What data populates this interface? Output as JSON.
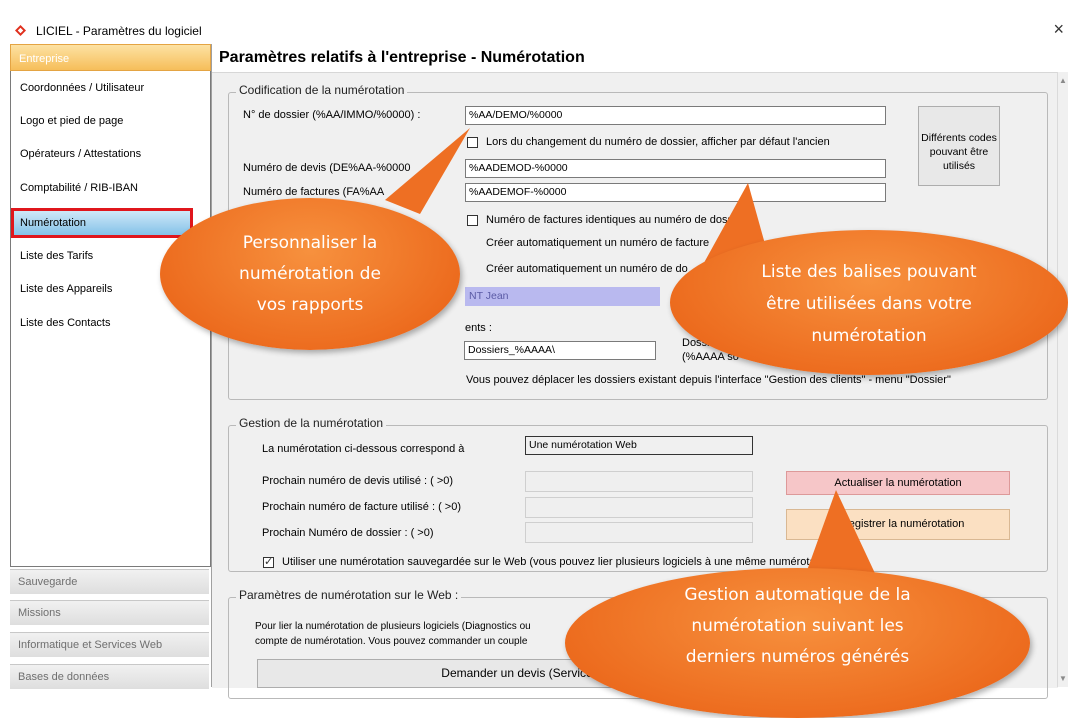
{
  "window": {
    "title": "LICIEL - Paramètres du logiciel",
    "close_glyph": "×"
  },
  "sidebar": {
    "header": "Entreprise",
    "items": [
      {
        "label": "Coordonnées / Utilisateur"
      },
      {
        "label": "Logo et pied de page"
      },
      {
        "label": "Opérateurs / Attestations"
      },
      {
        "label": "Comptabilité / RIB-IBAN"
      },
      {
        "label": "Numérotation",
        "selected": true
      },
      {
        "label": "Liste des Tarifs"
      },
      {
        "label": "Liste des Appareils"
      },
      {
        "label": "Liste des Contacts"
      }
    ],
    "groups": [
      "Sauvegarde",
      "Missions",
      "Informatique et Services Web",
      "Bases de données"
    ]
  },
  "main": {
    "title": "Paramètres relatifs à l'entreprise - Numérotation",
    "codification": {
      "legend": "Codification de la numérotation",
      "dossier_label": "N° de dossier (%AA/IMMO/%0000) :",
      "dossier_value": "%AA/DEMO/%0000",
      "change_checkbox": "Lors du changement du numéro de dossier, afficher par défaut l'ancien",
      "devis_label": "Numéro de devis (DE%AA-%0000",
      "devis_value": "%AADEMOD-%0000",
      "facture_label": "Numéro de factures (FA%AA",
      "facture_value": "%AADEMOF-%0000",
      "codes_button": "Différents codes pouvant être utilisés",
      "identiques_checkbox": "Numéro de factures identiques au numéro de dossier",
      "creer_facture_checkbox": "Créer automatiquement un numéro de facture",
      "creer_dossier_checkbox": "Créer automatiquement un numéro de do",
      "operator_value": "NT Jean",
      "documents_label": "ents :",
      "dossiers_value": "Dossiers_%AAAA\\",
      "dossier_hint_1": "Dossi",
      "dossier_hint_2": "(%AAAA so",
      "move_note": "Vous pouvez déplacer les dossiers existant depuis l'interface \"Gestion des clients\" - menu \"Dossier\""
    },
    "gestion": {
      "legend": "Gestion de la numérotation",
      "corresponds_label": "La numérotation ci-dessous correspond à",
      "corresponds_value": "Une numérotation Web",
      "next_devis_label": "Prochain numéro de devis utilisé :  ( >0)",
      "next_facture_label": "Prochain numéro de facture utilisé :  ( >0)",
      "next_dossier_label": "Prochain Numéro de dossier :  ( >0)",
      "refresh_button": "Actualiser la numérotation",
      "register_button": "Enregistrer la numérotation",
      "web_checkbox": "Utiliser une numérotation sauvegardée sur le Web (vous pouvez lier plusieurs logiciels à une même numérotation)"
    },
    "web": {
      "legend": "Paramètres de numérotation sur le Web :",
      "text_1": "Pour lier la numérotation de plusieurs logiciels (Diagnostics ou",
      "text_2": "compte de numérotation. Vous pouvez commander un couple",
      "devis_button": "Demander un devis (Service 24h/24"
    }
  },
  "callouts": [
    {
      "lines": [
        "Personnaliser la",
        "numérotation de",
        "vos rapports"
      ]
    },
    {
      "lines": [
        "Liste des balises pouvant",
        "être utilisées dans votre",
        "numérotation"
      ]
    },
    {
      "lines": [
        "Gestion automatique de la",
        "numérotation suivant les",
        "derniers numéros générés"
      ]
    }
  ],
  "colors": {
    "accent_orange": "#ee6f23",
    "sidebar_header": "#f6be5a",
    "selected_item": "#84c2e8",
    "selection_border": "#e0161c",
    "refresh_button": "#f6c6c8",
    "register_button": "#fbe0c2"
  }
}
